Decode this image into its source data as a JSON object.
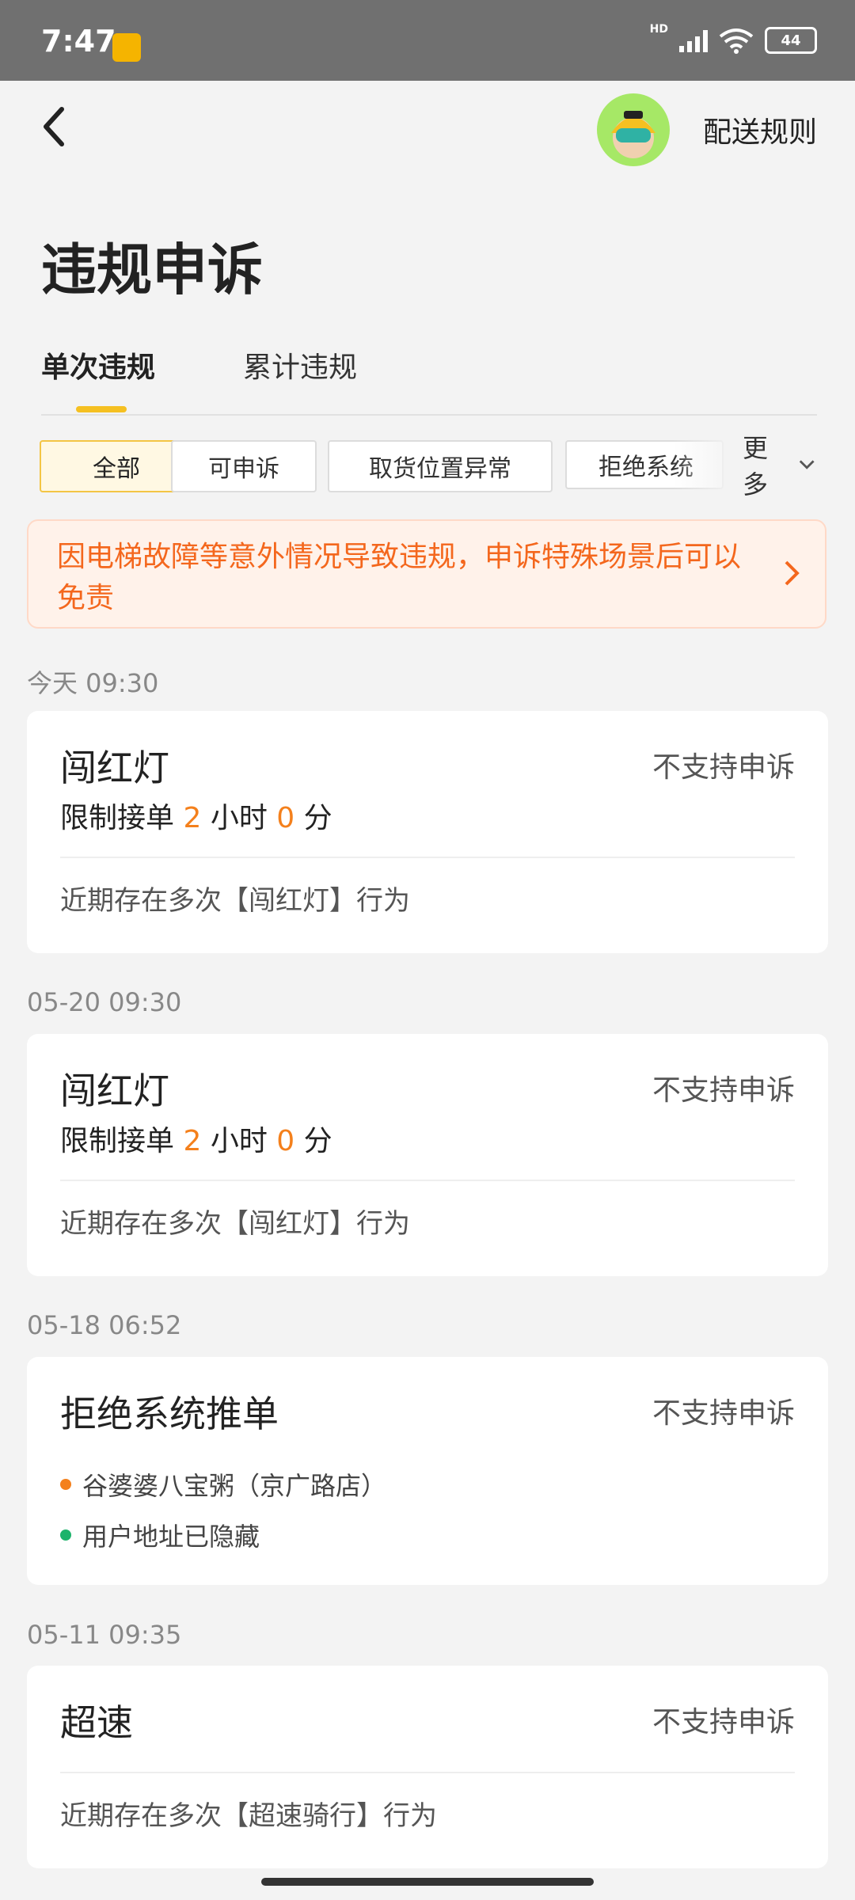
{
  "status_bar": {
    "time": "7:47",
    "network": "HD",
    "battery": "44"
  },
  "header": {
    "rules_link": "配送规则",
    "title": "违规申诉"
  },
  "tabs": [
    "单次违规",
    "累计违规"
  ],
  "filters": {
    "chips": [
      "全部",
      "可申诉",
      "取货位置异常",
      "拒绝系统"
    ],
    "more": "更多"
  },
  "banner": {
    "text": "因电梯故障等意外情况导致违规，申诉特殊场景后可以免责"
  },
  "records": [
    {
      "date": "今天 09:30",
      "title": "闯红灯",
      "status": "不支持申诉",
      "limit_prefix": "限制接单",
      "hours": "2",
      "hours_unit": "小时",
      "minutes": "0",
      "minutes_unit": "分",
      "note": "近期存在多次【闯红灯】行为"
    },
    {
      "date": "05-20 09:30",
      "title": "闯红灯",
      "status": "不支持申诉",
      "limit_prefix": "限制接单",
      "hours": "2",
      "hours_unit": "小时",
      "minutes": "0",
      "minutes_unit": "分",
      "note": "近期存在多次【闯红灯】行为"
    },
    {
      "date": "05-18 06:52",
      "title": "拒绝系统推单",
      "status": "不支持申诉",
      "shop": "谷婆婆八宝粥（京广路店）",
      "customer": "用户地址已隐藏"
    },
    {
      "date": "05-11 09:35",
      "title": "超速",
      "status": "不支持申诉",
      "note": "近期存在多次【超速骑行】行为"
    }
  ],
  "colors": {
    "accent": "#f5c021",
    "orange": "#f4671d",
    "shop_dot": "#f4801c",
    "customer_dot": "#1db36b"
  },
  "icons": [
    "back-icon",
    "avatar",
    "chevron-down-icon",
    "chevron-right-icon",
    "wifi-icon",
    "signal-icon",
    "battery-icon"
  ]
}
